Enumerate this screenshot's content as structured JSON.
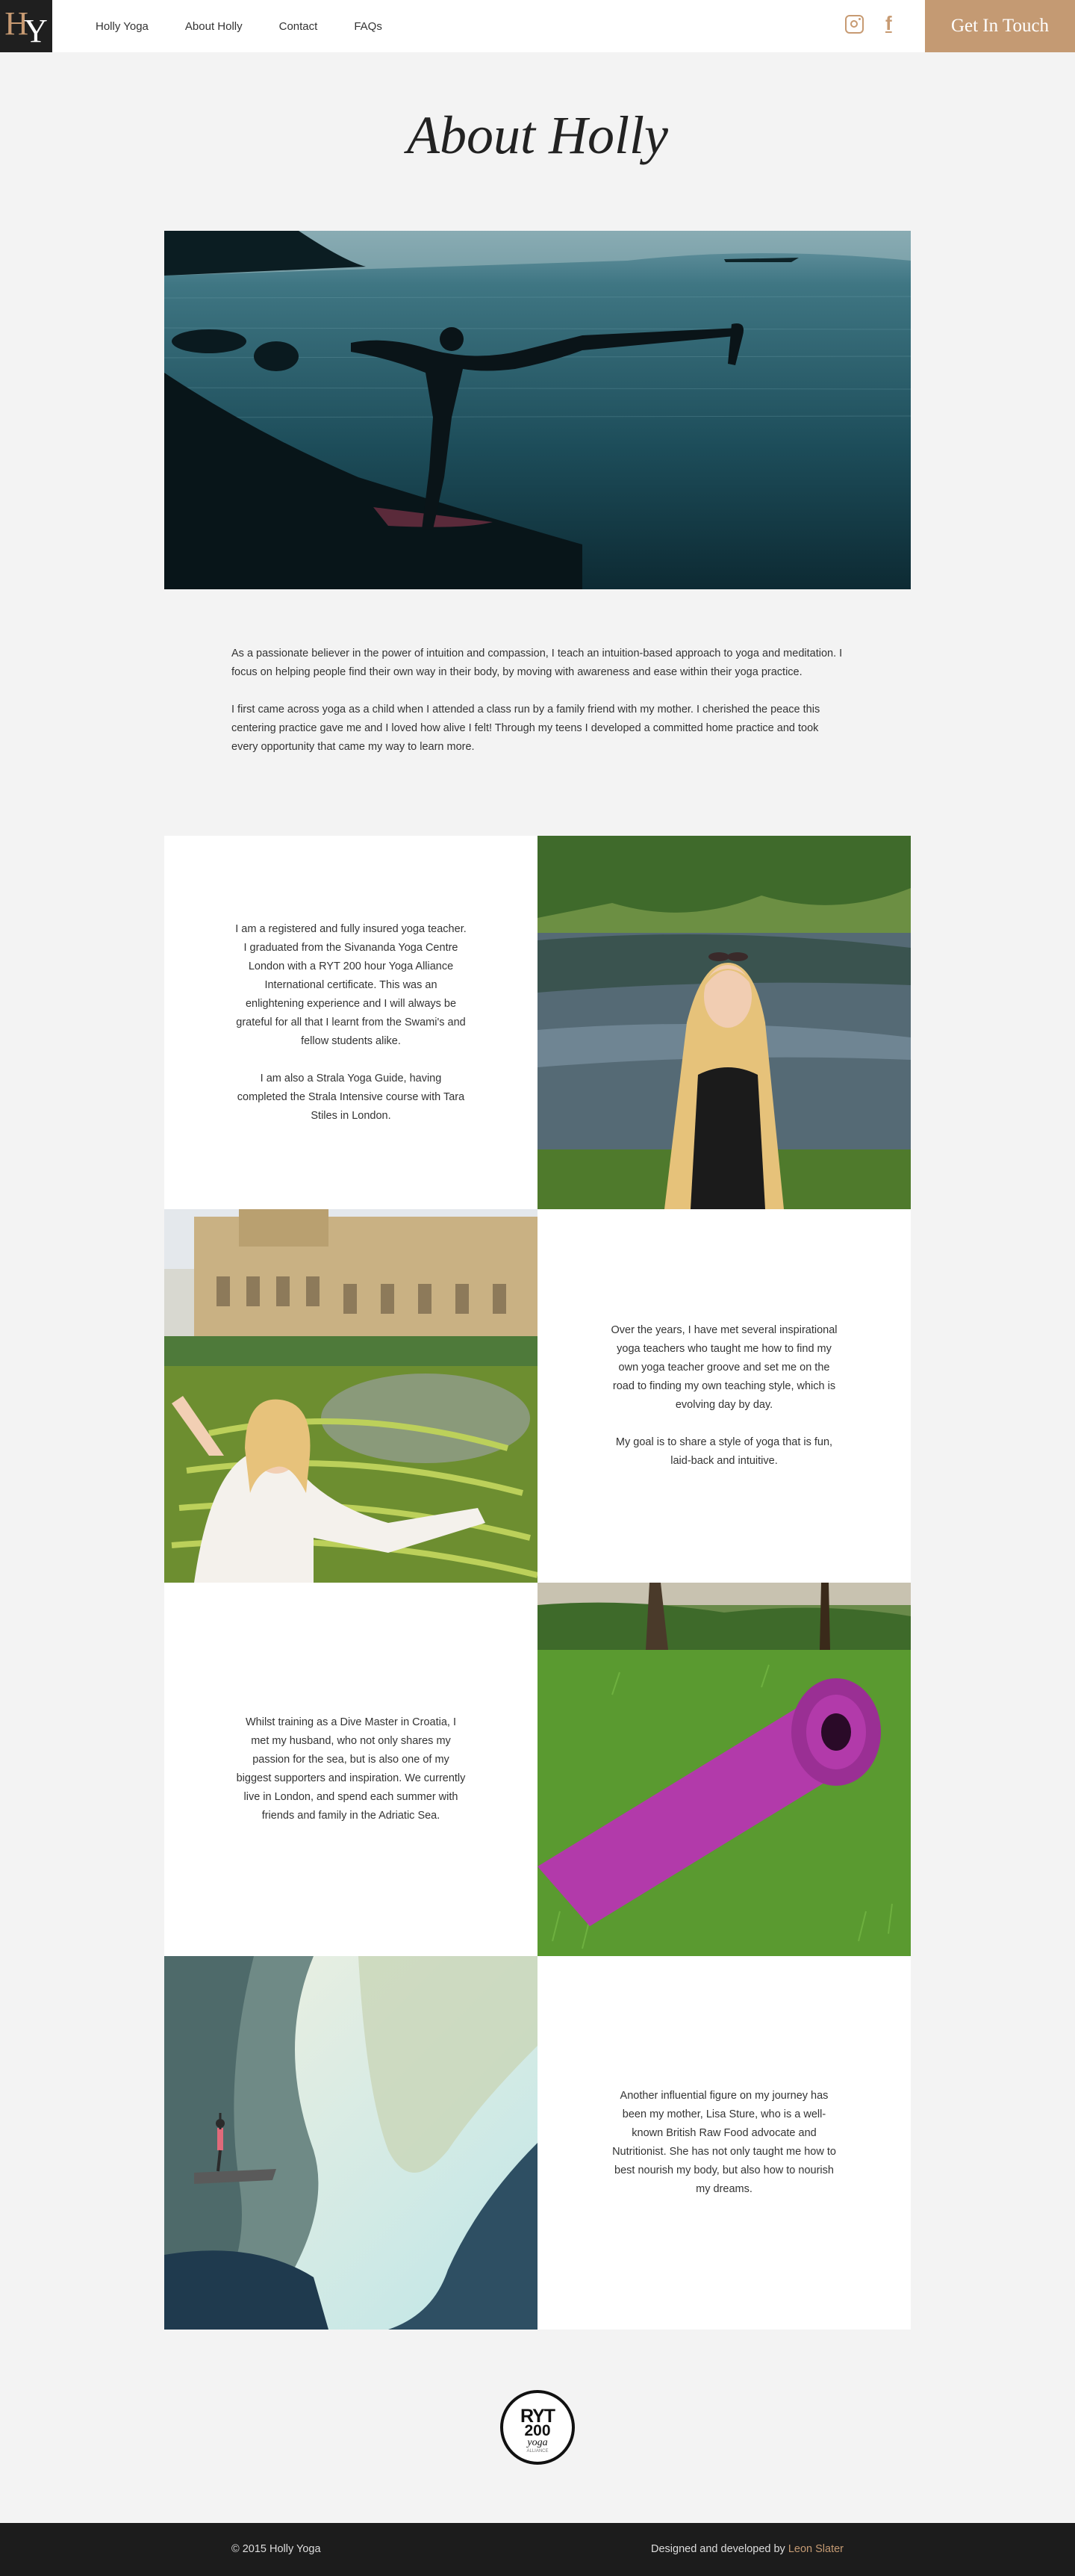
{
  "header": {
    "logo_text": "HY",
    "nav": [
      "Holly Yoga",
      "About Holly",
      "Contact",
      "FAQs"
    ],
    "social_icons": [
      "instagram-icon",
      "facebook-icon"
    ],
    "cta_label": "Get In Touch",
    "accent_color": "#c49a73"
  },
  "page": {
    "title": "About Holly"
  },
  "intro": {
    "p1": "As a passionate believer in the power of intuition and compassion, I teach an intuition-based approach to yoga and meditation. I focus on helping people find their own way in their body, by moving with awareness and ease within their yoga practice.",
    "p2": "I first came across yoga as a child when I attended a class run by a family friend with my mother. I cherished the peace this centering practice gave me and I loved how alive I felt! Through my teens I developed a committed home practice and took every opportunity that came my way to learn more."
  },
  "grid": {
    "block1": {
      "p1": "I am a registered and fully insured yoga teacher. I graduated from the Sivananda Yoga Centre London with a RYT 200 hour Yoga Alliance International certificate. This was an enlightening experience and I will always be grateful for all that I learnt from the Swami's and fellow students alike.",
      "p2": "I am also a Strala Yoga Guide, having completed the Strala Intensive course with Tara Stiles in London."
    },
    "block2": {
      "p1": "Over the years, I have met several inspirational yoga teachers who taught me how to find my own yoga teacher groove and set me on the road to finding my own teaching style, which is evolving day by day.",
      "p2": "My goal is to share a style of yoga that is fun, laid-back and intuitive."
    },
    "block3": {
      "p1": "Whilst training as a Dive Master in Croatia, I met my husband, who not only shares my passion for the sea, but is also one of my biggest supporters and inspiration. We currently live in London, and spend each summer with friends and family in the Adriatic Sea."
    },
    "block4": {
      "p1": "Another influential figure on my journey has been my mother, Lisa Sture, who is a well-known British Raw Food advocate and Nutritionist. She has not only taught me how to best nourish my body, but also how to nourish my dreams."
    }
  },
  "badge": {
    "line1": "RYT",
    "line2": "200",
    "line3": "yoga",
    "line4": "ALLIANCE"
  },
  "footer": {
    "copyright": "© 2015 Holly Yoga",
    "credit_prefix": "Designed and developed by",
    "credit_name": "Leon Slater"
  }
}
